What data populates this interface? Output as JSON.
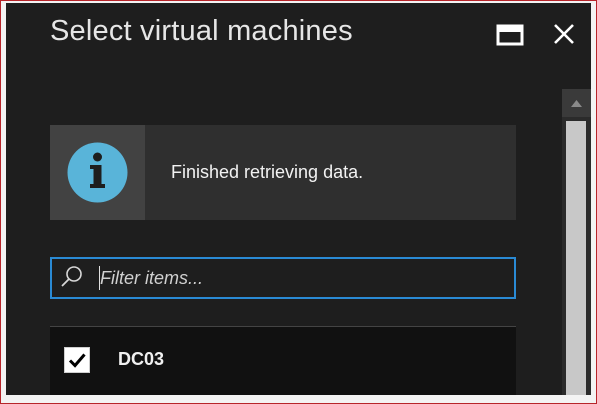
{
  "blade": {
    "title": "Select virtual machines"
  },
  "window_controls": {
    "maximize_icon": "maximize-icon",
    "close_icon": "close-icon"
  },
  "notification": {
    "icon": "info-icon",
    "message": "Finished retrieving data."
  },
  "filter": {
    "placeholder": "Filter items...",
    "value": "",
    "icon": "search-icon"
  },
  "vm_list": {
    "items": [
      {
        "name": "DC03",
        "checked": true
      }
    ]
  },
  "colors": {
    "background": "#1e1e1e",
    "accent_blue": "#2a8ad4",
    "info_icon": "#59b4d9",
    "frame_border": "#b7252a",
    "text": "#f0f0f0"
  }
}
